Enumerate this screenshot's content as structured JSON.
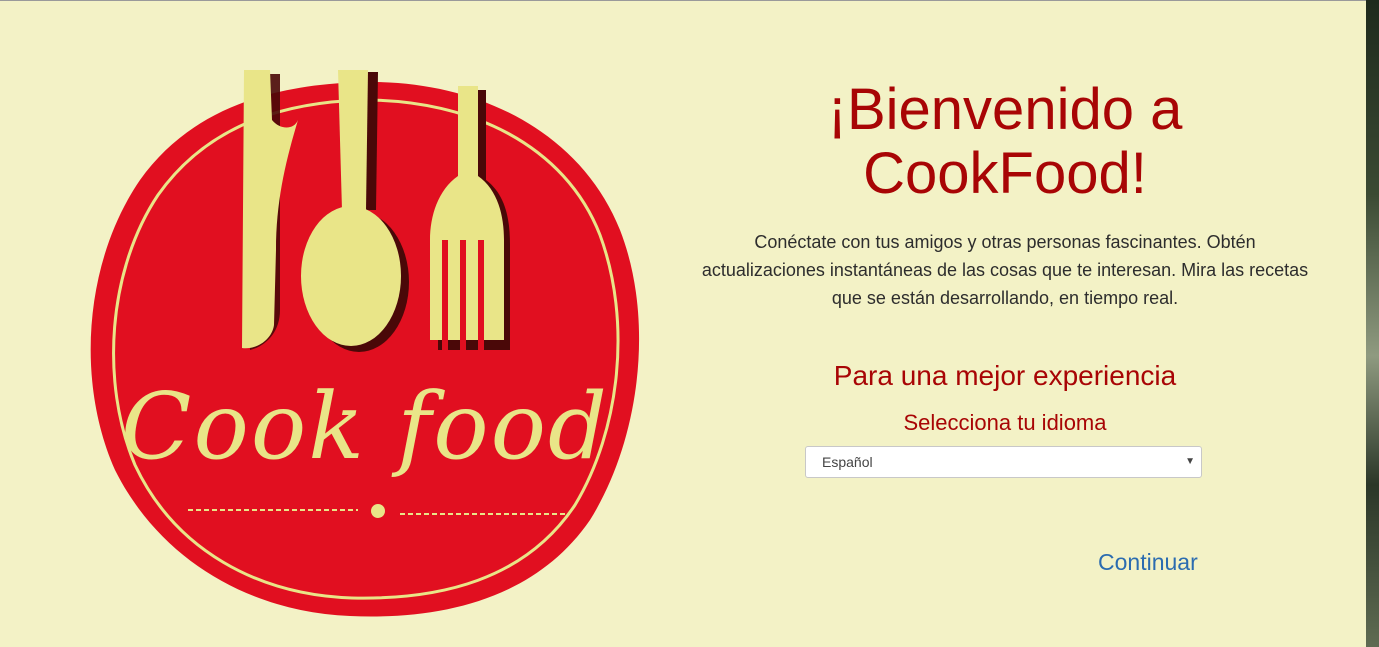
{
  "logo": {
    "script_text": "Cook food",
    "colors": {
      "circle_red": "#e10f20",
      "cream": "#e9e588",
      "shadow": "#5a0a0a"
    },
    "icons": [
      "knife-icon",
      "spoon-icon",
      "fork-icon"
    ]
  },
  "welcome": {
    "title_line1": "¡Bienvenido a",
    "title_line2": "CookFood!",
    "description": "Conéctate con tus amigos y otras personas fascinantes. Obtén actualizaciones instantáneas de las cosas que te interesan. Mira las recetas que se están desarrollando, en tiempo real."
  },
  "language": {
    "heading": "Para una mejor experiencia",
    "label": "Selecciona tu idioma",
    "selected": "Español"
  },
  "actions": {
    "continue_label": "Continuar"
  },
  "colors": {
    "background": "#f3f2c6",
    "accent_red": "#a80505",
    "link_blue": "#2b6cb0"
  }
}
